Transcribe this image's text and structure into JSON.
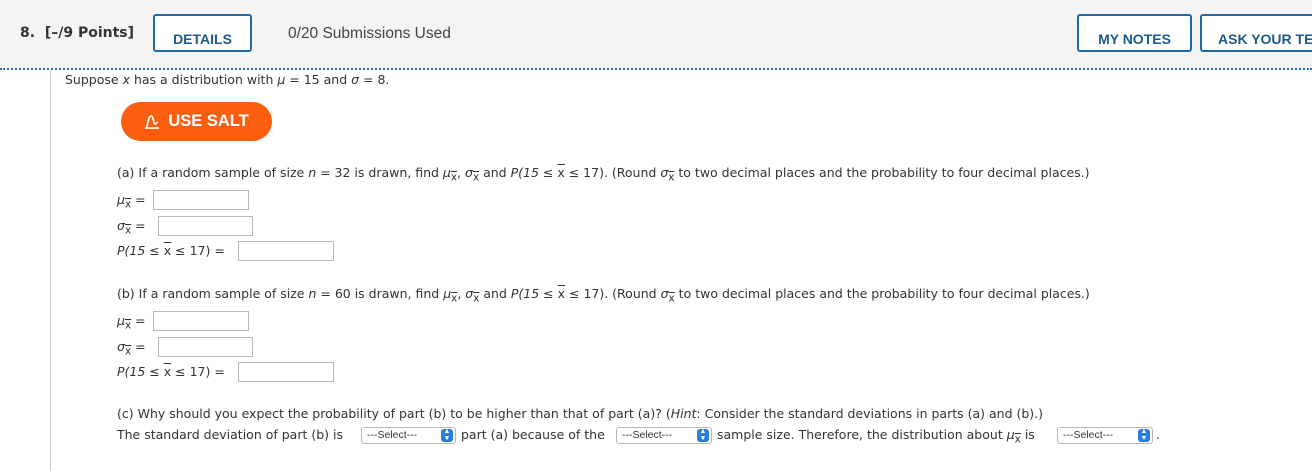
{
  "header": {
    "question_number": "8.",
    "points": "[–/9 Points]",
    "details_label": "DETAILS",
    "submissions": "0/20 Submissions Used",
    "my_notes_label": "MY NOTES",
    "ask_teacher_label": "ASK YOUR TE"
  },
  "intro": {
    "prefix": "Suppose ",
    "var": "x",
    "mid": " has a distribution with ",
    "mu_sym": "μ",
    "mu_eq": " = 15 and ",
    "sigma_sym": "σ",
    "sigma_eq": " = 8."
  },
  "salt": {
    "label": "USE SALT",
    "icon": "salt-chart-icon"
  },
  "part_a": {
    "q1": "(a) If a random sample of size ",
    "n_sym": "n",
    "q2": " = 32 is drawn, find ",
    "q3": " and ",
    "prob_p": "P(15 ≤ ",
    "prob_end": " ≤ 17). (Round ",
    "q4": " to two decimal places and the probability to four decimal places.)"
  },
  "part_b": {
    "q1": "(b) If a random sample of size ",
    "n_sym": "n",
    "q2": " = 60 is drawn, find ",
    "q3": " and ",
    "prob_p": "P(15 ≤ ",
    "prob_end": " ≤ 17). (Round ",
    "q4": " to two decimal places and the probability to four decimal places.)"
  },
  "labels": {
    "mu": "μ",
    "sigma": "σ",
    "xbar": "x",
    "eq": " =",
    "comma": ",",
    "prob_lead": "P(15 ≤ ",
    "prob_tail": " ≤ 17)  ="
  },
  "inputs": {
    "a_mu": "",
    "a_sigma": "",
    "a_prob": "",
    "b_mu": "",
    "b_sigma": "",
    "b_prob": ""
  },
  "part_c": {
    "question": "(c) Why should you expect the probability of part (b) to be higher than that of part (a)? (",
    "hint_label": "Hint",
    "hint_text": ": Consider the standard deviations in parts (a) and (b).)",
    "s1": "The standard deviation of part (b) is",
    "s2": "part (a) because of the",
    "s3": "sample size. Therefore, the distribution about",
    "s4": "is",
    "s5": ".",
    "select1": "---Select---",
    "select2": "---Select---",
    "select3": "---Select---"
  },
  "colors": {
    "accent": "#1d6aa6",
    "salt": "#fa5f0f",
    "select_chevron": "#2b7de0"
  }
}
